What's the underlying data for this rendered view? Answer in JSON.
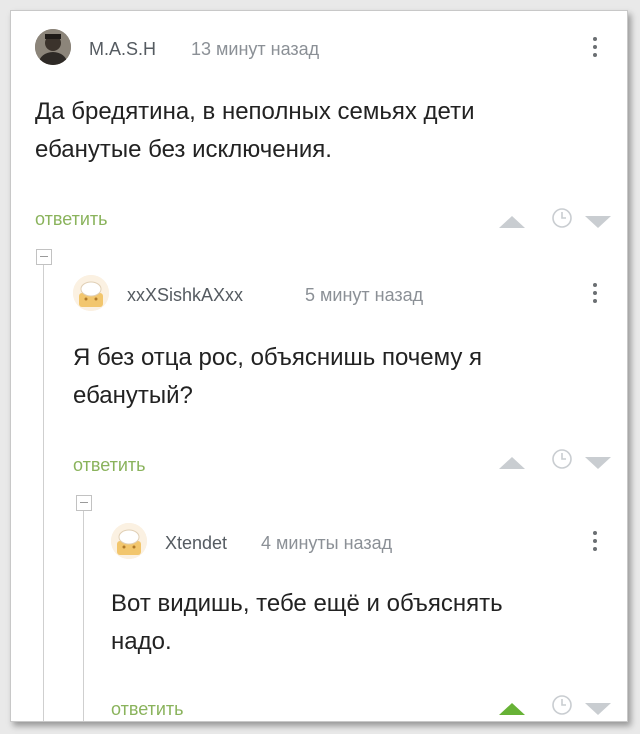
{
  "colors": {
    "reply_green": "#8ab35c",
    "vote_grey": "#c9cdd1",
    "vote_up_active": "#67b236",
    "text": "#222222",
    "meta": "#8b9096"
  },
  "comments": [
    {
      "username": "M.A.S.H",
      "time": "13 минут назад",
      "text_line1": "Да бредятина, в неполных семьях дети",
      "text_line2": "ебанутые без исключения.",
      "reply_label": "ответить",
      "upvoted": false,
      "icons": [
        "avatar-photo",
        "more-vertical-icon",
        "upvote-arrow-icon",
        "clock-icon",
        "downvote-arrow-icon"
      ]
    },
    {
      "username": "xxXSishkAXxx",
      "time": "5 минут назад",
      "text_line1": "Я без отца рос, объяснишь почему я",
      "text_line2": "ебанутый?",
      "reply_label": "ответить",
      "upvoted": false,
      "icons": [
        "default-avatar-icon",
        "collapse-thread-icon",
        "more-vertical-icon",
        "upvote-arrow-icon",
        "clock-icon",
        "downvote-arrow-icon"
      ]
    },
    {
      "username": "Xtendet",
      "time": "4 минуты назад",
      "text_line1": "Вот видишь, тебе ещё и объяснять",
      "text_line2": "надо.",
      "reply_label": "ответить",
      "upvoted": true,
      "icons": [
        "default-avatar-icon",
        "collapse-thread-icon",
        "more-vertical-icon",
        "upvote-arrow-icon",
        "clock-icon",
        "downvote-arrow-icon"
      ]
    }
  ]
}
